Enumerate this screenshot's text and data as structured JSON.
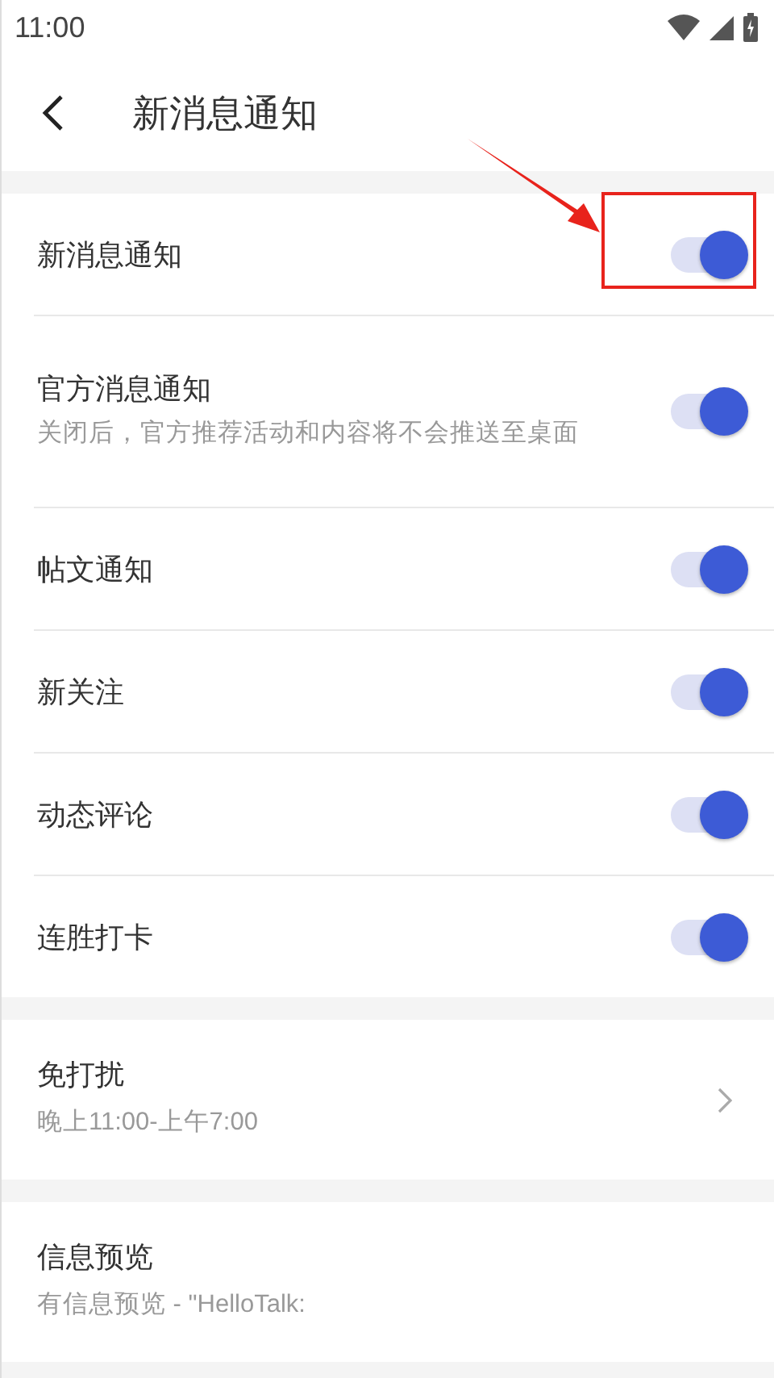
{
  "status_bar": {
    "time": "11:00"
  },
  "header": {
    "title": "新消息通知"
  },
  "toggles": [
    {
      "label": "新消息通知",
      "on": true,
      "highlighted": true
    },
    {
      "label": "官方消息通知",
      "description": "关闭后，官方推荐活动和内容将不会推送至桌面",
      "on": true,
      "highlighted": false
    },
    {
      "label": "帖文通知",
      "on": true,
      "highlighted": false
    },
    {
      "label": "新关注",
      "on": true,
      "highlighted": false
    },
    {
      "label": "动态评论",
      "on": true,
      "highlighted": false
    },
    {
      "label": "连胜打卡",
      "on": true,
      "highlighted": false
    }
  ],
  "links": [
    {
      "label": "免打扰",
      "value": "晚上11:00-上午7:00",
      "chevron": true
    },
    {
      "label": "信息预览",
      "value": "有信息预览 - \"HelloTalk:",
      "chevron": false
    }
  ]
}
